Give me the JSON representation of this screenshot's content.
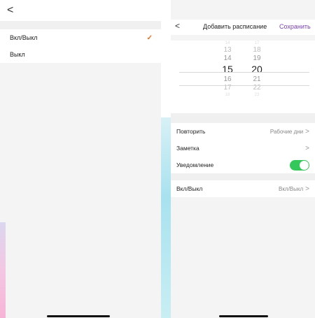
{
  "left": {
    "back_glyph": "<",
    "options": [
      {
        "label": "Вкл/Выкл",
        "selected": true
      },
      {
        "label": "Выкл",
        "selected": false
      }
    ],
    "check_glyph": "✓"
  },
  "right": {
    "back_glyph": "<",
    "title": "Добавить расписание",
    "save_label": "Сохранить",
    "picker": {
      "hours": [
        "14",
        "13",
        "14",
        "15",
        "16",
        "17",
        "18"
      ],
      "minutes": [
        "17",
        "18",
        "19",
        "20",
        "21",
        "22",
        "23"
      ],
      "selected_hour": "15",
      "selected_minute": "20"
    },
    "settings": [
      {
        "label": "Повторить",
        "value": "Рабочие дни",
        "chevron": ">"
      },
      {
        "label": "Заметка",
        "value": "",
        "chevron": ">"
      },
      {
        "label": "Уведомление",
        "toggle": true
      }
    ],
    "onoff": {
      "label": "Вкл/Выкл",
      "value": "Вкл/Выкл",
      "chevron": ">"
    }
  },
  "colors": {
    "accent_check": "#f26b1f",
    "save_purple": "#7a3fb0",
    "toggle_on": "#34c759"
  }
}
